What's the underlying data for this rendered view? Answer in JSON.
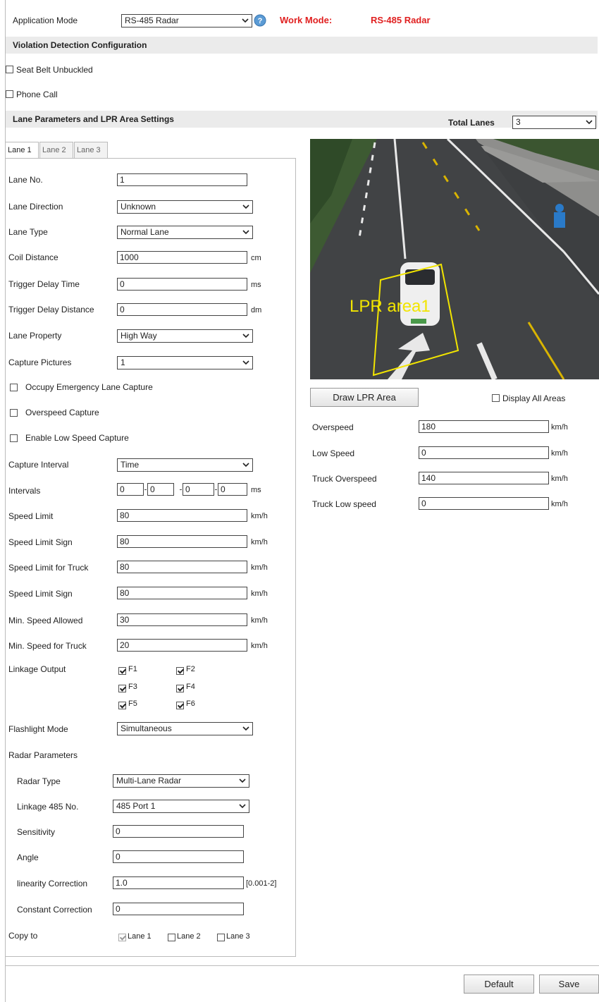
{
  "app_mode": {
    "label": "Application Mode",
    "value": "RS-485 Radar",
    "work_mode_label": "Work Mode:",
    "work_mode_value": "RS-485 Radar"
  },
  "violation": {
    "title": "Violation Detection Configuration",
    "seat_belt": "Seat Belt Unbuckled",
    "phone_call": "Phone Call"
  },
  "lane_section": {
    "title": "Lane Parameters and LPR Area Settings",
    "total_lanes_label": "Total Lanes",
    "total_lanes_value": "3"
  },
  "tabs": [
    "Lane 1",
    "Lane 2",
    "Lane 3"
  ],
  "lane": {
    "lane_no": {
      "label": "Lane No.",
      "value": "1"
    },
    "lane_direction": {
      "label": "Lane Direction",
      "value": "Unknown"
    },
    "lane_type": {
      "label": "Lane Type",
      "value": "Normal Lane"
    },
    "coil_distance": {
      "label": "Coil Distance",
      "value": "1000",
      "unit": "cm"
    },
    "trigger_delay_time": {
      "label": "Trigger Delay Time",
      "value": "0",
      "unit": "ms"
    },
    "trigger_delay_distance": {
      "label": "Trigger Delay Distance",
      "value": "0",
      "unit": "dm"
    },
    "lane_property": {
      "label": "Lane Property",
      "value": "High Way"
    },
    "capture_pictures": {
      "label": "Capture Pictures",
      "value": "1"
    },
    "occupy_emergency": "Occupy Emergency Lane Capture",
    "overspeed_capture": "Overspeed Capture",
    "low_speed_capture": "Enable Low Speed Capture",
    "capture_interval": {
      "label": "Capture Interval",
      "value": "Time"
    },
    "intervals": {
      "label": "Intervals",
      "values": [
        "0",
        "0",
        "0",
        "0"
      ],
      "unit": "ms"
    },
    "speed_limit": {
      "label": "Speed Limit",
      "value": "80",
      "unit": "km/h"
    },
    "speed_limit_sign": {
      "label": "Speed Limit Sign",
      "value": "80",
      "unit": "km/h"
    },
    "speed_limit_truck": {
      "label": "Speed Limit for Truck",
      "value": "80",
      "unit": "km/h"
    },
    "speed_limit_sign2": {
      "label": "Speed Limit Sign",
      "value": "80",
      "unit": "km/h"
    },
    "min_speed": {
      "label": "Min. Speed Allowed",
      "value": "30",
      "unit": "km/h"
    },
    "min_speed_truck": {
      "label": "Min. Speed for Truck",
      "value": "20",
      "unit": "km/h"
    },
    "linkage_output": {
      "label": "Linkage Output",
      "outputs": [
        "F1",
        "F2",
        "F3",
        "F4",
        "F5",
        "F6"
      ]
    },
    "flashlight_mode": {
      "label": "Flashlight Mode",
      "value": "Simultaneous"
    },
    "radar_params": "Radar Parameters",
    "radar_type": {
      "label": "Radar Type",
      "value": "Multi-Lane Radar"
    },
    "linkage_485": {
      "label": "Linkage 485 No.",
      "value": "485 Port 1"
    },
    "sensitivity": {
      "label": "Sensitivity",
      "value": "0"
    },
    "angle": {
      "label": "Angle",
      "value": "0"
    },
    "linearity": {
      "label": "linearity Correction",
      "value": "1.0",
      "range": "[0.001-2]"
    },
    "constant": {
      "label": "Constant Correction",
      "value": "0"
    },
    "copy_to": {
      "label": "Copy to",
      "lanes": [
        "Lane 1",
        "Lane 2",
        "Lane 3"
      ]
    }
  },
  "preview": {
    "area_label": "LPR area1",
    "draw_button": "Draw LPR Area",
    "display_all": "Display All Areas"
  },
  "right": {
    "overspeed": {
      "label": "Overspeed",
      "value": "180",
      "unit": "km/h"
    },
    "low_speed": {
      "label": "Low Speed",
      "value": "0",
      "unit": "km/h"
    },
    "truck_overspeed": {
      "label": "Truck Overspeed",
      "value": "140",
      "unit": "km/h"
    },
    "truck_low_speed": {
      "label": "Truck Low speed",
      "value": "0",
      "unit": "km/h"
    }
  },
  "footer": {
    "default": "Default",
    "save": "Save"
  },
  "colors": {
    "accent_red": "#e02020",
    "section_bg": "#ebebeb",
    "lpr_box": "#f2e500"
  }
}
